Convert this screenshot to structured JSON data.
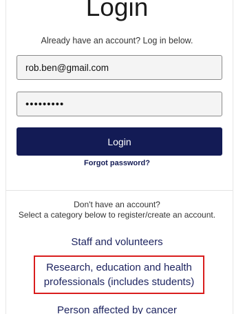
{
  "login": {
    "title": "Login",
    "subtitle": "Already have an account? Log in below.",
    "email_value": "rob.ben@gmail.com",
    "password_value": "•••••••••",
    "button_label": "Login",
    "forgot_password": "Forgot password?"
  },
  "register": {
    "prompt": "Don't have an account?",
    "instruction": "Select a category below to register/create an account.",
    "categories": [
      {
        "label": "Staff and volunteers"
      },
      {
        "label_line1": "Research, education and health",
        "label_line2": "professionals (includes students)",
        "highlighted": true
      },
      {
        "label": "Person affected by cancer"
      }
    ]
  },
  "colors": {
    "primary_button": "#131b55",
    "link": "#1d2460",
    "highlight_border": "#d91c1c",
    "input_background": "#f4f4f4"
  }
}
